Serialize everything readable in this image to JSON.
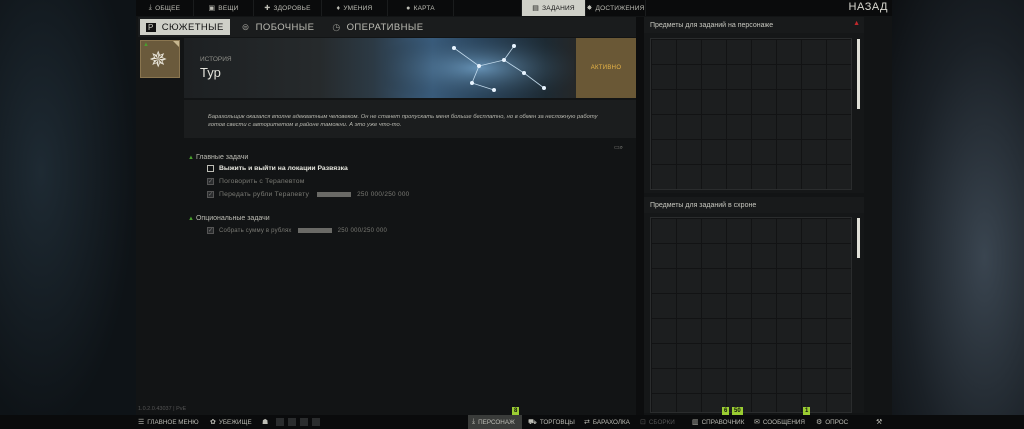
{
  "topnav": {
    "tabs": [
      {
        "label": "ОБЩЕЕ",
        "icon": "download-icon",
        "active": false
      },
      {
        "label": "ВЕЩИ",
        "icon": "lock-icon",
        "active": false
      },
      {
        "label": "ЗДОРОВЬЕ",
        "icon": "plus-icon",
        "active": false
      },
      {
        "label": "УМЕНИЯ",
        "icon": "chevron-icon",
        "active": false
      },
      {
        "label": "КАРТА",
        "icon": "pin-icon",
        "active": false
      },
      {
        "label": "ЗАДАНИЯ",
        "icon": "book-icon",
        "active": true
      },
      {
        "label": "ДОСТИЖЕНИЯ",
        "icon": "gear-icon",
        "active": false
      }
    ],
    "back": "НАЗАД"
  },
  "subtabs": [
    {
      "label": "СЮЖЕТНЫЕ",
      "icon": "p-icon",
      "active": true
    },
    {
      "label": "ПОБОЧНЫЕ",
      "icon": "toggle-icon",
      "active": false
    },
    {
      "label": "ОПЕРАТИВНЫЕ",
      "icon": "clock-icon",
      "active": false
    }
  ],
  "quest": {
    "category": "ИСТОРИЯ",
    "title": "Тур",
    "status": "АКТИВНО",
    "description": "Барахольщик оказался вполне адекватным человеком. Он не станет пропускать меня больше бесплатно, но в обмен за несложную работу готов свести с авторитетом в районе таможни. А это уже что-то."
  },
  "objectives": {
    "main_title": "Главные задачи",
    "main": [
      {
        "label": "Выжить и выйти на локации Развязка",
        "done": false
      },
      {
        "label": "Поговорить с Терапевтом",
        "done": true
      },
      {
        "label": "Передать рубли Терапевту",
        "done": true,
        "progress": 1.0,
        "count": "250 000/250 000"
      }
    ],
    "optional_title": "Опциональные задачи",
    "optional": [
      {
        "label": "Собрать сумму в рублях",
        "done": true,
        "progress": 1.0,
        "count": "250 000/250 000"
      }
    ]
  },
  "version": "1.0.2.0.43037 | PvE",
  "right": {
    "panel1_title": "Предметы для заданий на персонаже",
    "panel2_title": "Предметы для заданий в схроне"
  },
  "bottom": {
    "main_menu": "ГЛАВНОЕ МЕНЮ",
    "hideout": "УБЕЖИЩЕ",
    "character": "ПЕРСОНАЖ",
    "traders": "ТОРГОВЦЫ",
    "flea": "БАРАХОЛКА",
    "builds": "СБОРКИ",
    "handbook": "СПРАВОЧНИК",
    "messages": "СООБЩЕНИЯ",
    "survey": "ОПРОС",
    "badge_character": "8",
    "badge_handbook_a": "6",
    "badge_handbook_b": "50",
    "badge_messages": "1"
  },
  "colors": {
    "active_tab": "#cfd0c8",
    "status_text": "#e9b547",
    "accent_green": "#4a9f2e",
    "badge": "#9acd32",
    "alert": "#c0282c"
  }
}
